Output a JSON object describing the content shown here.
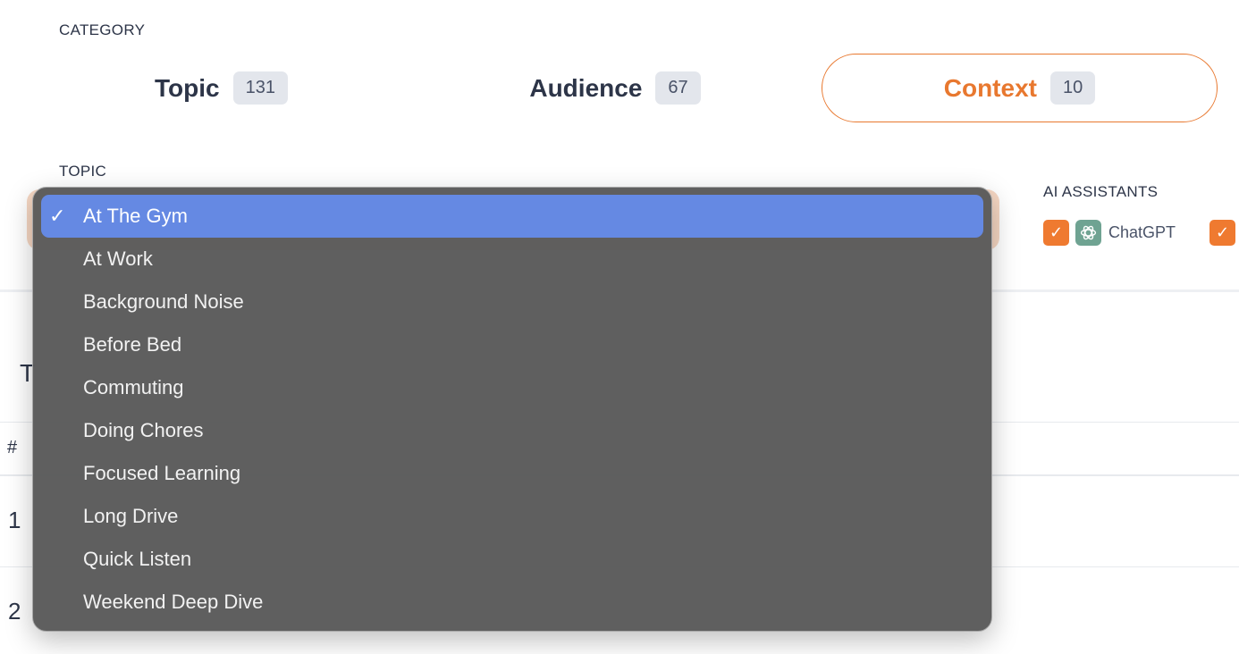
{
  "category": {
    "label": "CATEGORY",
    "tabs": [
      {
        "name": "Topic",
        "count": "131"
      },
      {
        "name": "Audience",
        "count": "67"
      },
      {
        "name": "Context",
        "count": "10"
      }
    ],
    "active_tab": "Context",
    "accent_color": "#e8782f"
  },
  "topic": {
    "label": "TOPIC",
    "selected": "At The Gym",
    "options": [
      "At The Gym",
      "At Work",
      "Background Noise",
      "Before Bed",
      "Commuting",
      "Doing Chores",
      "Focused Learning",
      "Long Drive",
      "Quick Listen",
      "Weekend Deep Dive"
    ]
  },
  "ai_assistants": {
    "label": "AI ASSISTANTS",
    "items": [
      {
        "name": "ChatGPT",
        "checked": true,
        "icon": "chatgpt-logo-icon"
      }
    ]
  },
  "table": {
    "title_stub": "T",
    "hash_header": "#",
    "rows": [
      {
        "rank": "1"
      },
      {
        "rank": "2"
      }
    ]
  },
  "colors": {
    "selection_highlight": "#6589e3",
    "checkbox": "#ef7a30"
  }
}
